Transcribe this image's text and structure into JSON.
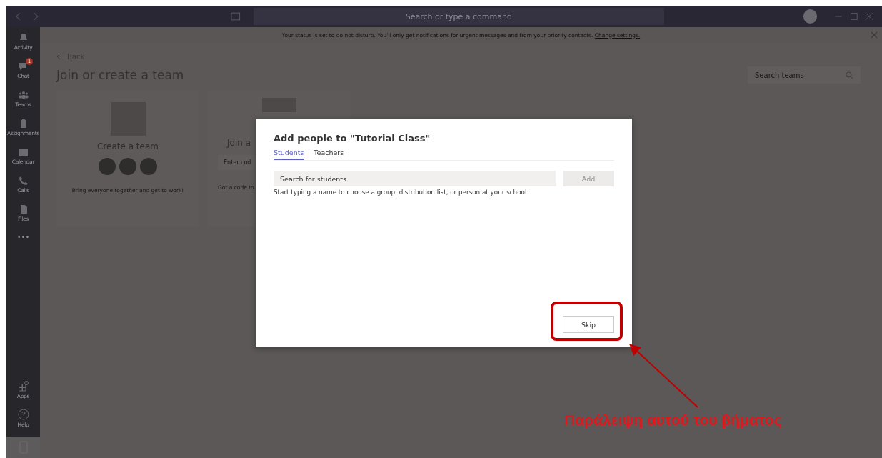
{
  "title_bar": {
    "search": {
      "placeholder": "Search or type a command"
    }
  },
  "rail": {
    "items": [
      {
        "label": "Activity",
        "kind": "bell"
      },
      {
        "label": "Chat",
        "kind": "chat",
        "badge": "1"
      },
      {
        "label": "Teams",
        "kind": "teams"
      },
      {
        "label": "Assignments",
        "kind": "assign"
      },
      {
        "label": "Calendar",
        "kind": "calendar"
      },
      {
        "label": "Calls",
        "kind": "phone"
      },
      {
        "label": "Files",
        "kind": "file"
      }
    ],
    "more": "•••",
    "bottom_items": [
      {
        "label": "Apps",
        "kind": "apps"
      },
      {
        "label": "Help",
        "kind": "help"
      }
    ]
  },
  "banner": {
    "text": "Your status is set to do not disturb. You'll only get notifications for urgent messages and from your priority contacts.",
    "link": "Change settings."
  },
  "page": {
    "back": "Back",
    "title": "Join or create a team",
    "search": {
      "placeholder": "Search teams"
    },
    "cards": [
      {
        "kind": "create",
        "title": "Create a team",
        "description": "Bring everyone together and get to work!"
      },
      {
        "kind": "join",
        "title": "Join a",
        "field": "Enter cod",
        "description": "Got a code to"
      }
    ]
  },
  "dialog": {
    "title": "Add people to \"Tutorial Class\"",
    "tabs": [
      {
        "label": "Students",
        "selected": true
      },
      {
        "label": "Teachers",
        "selected": false
      }
    ],
    "search": {
      "placeholder": "Search for students"
    },
    "add_button": {
      "label": "Add",
      "disabled": true
    },
    "hint": "Start typing a name to choose a group, distribution list, or person at your school.",
    "skip_button": "Skip"
  },
  "annotation": {
    "text": "Παράλειψη αυτού του βήματος"
  }
}
